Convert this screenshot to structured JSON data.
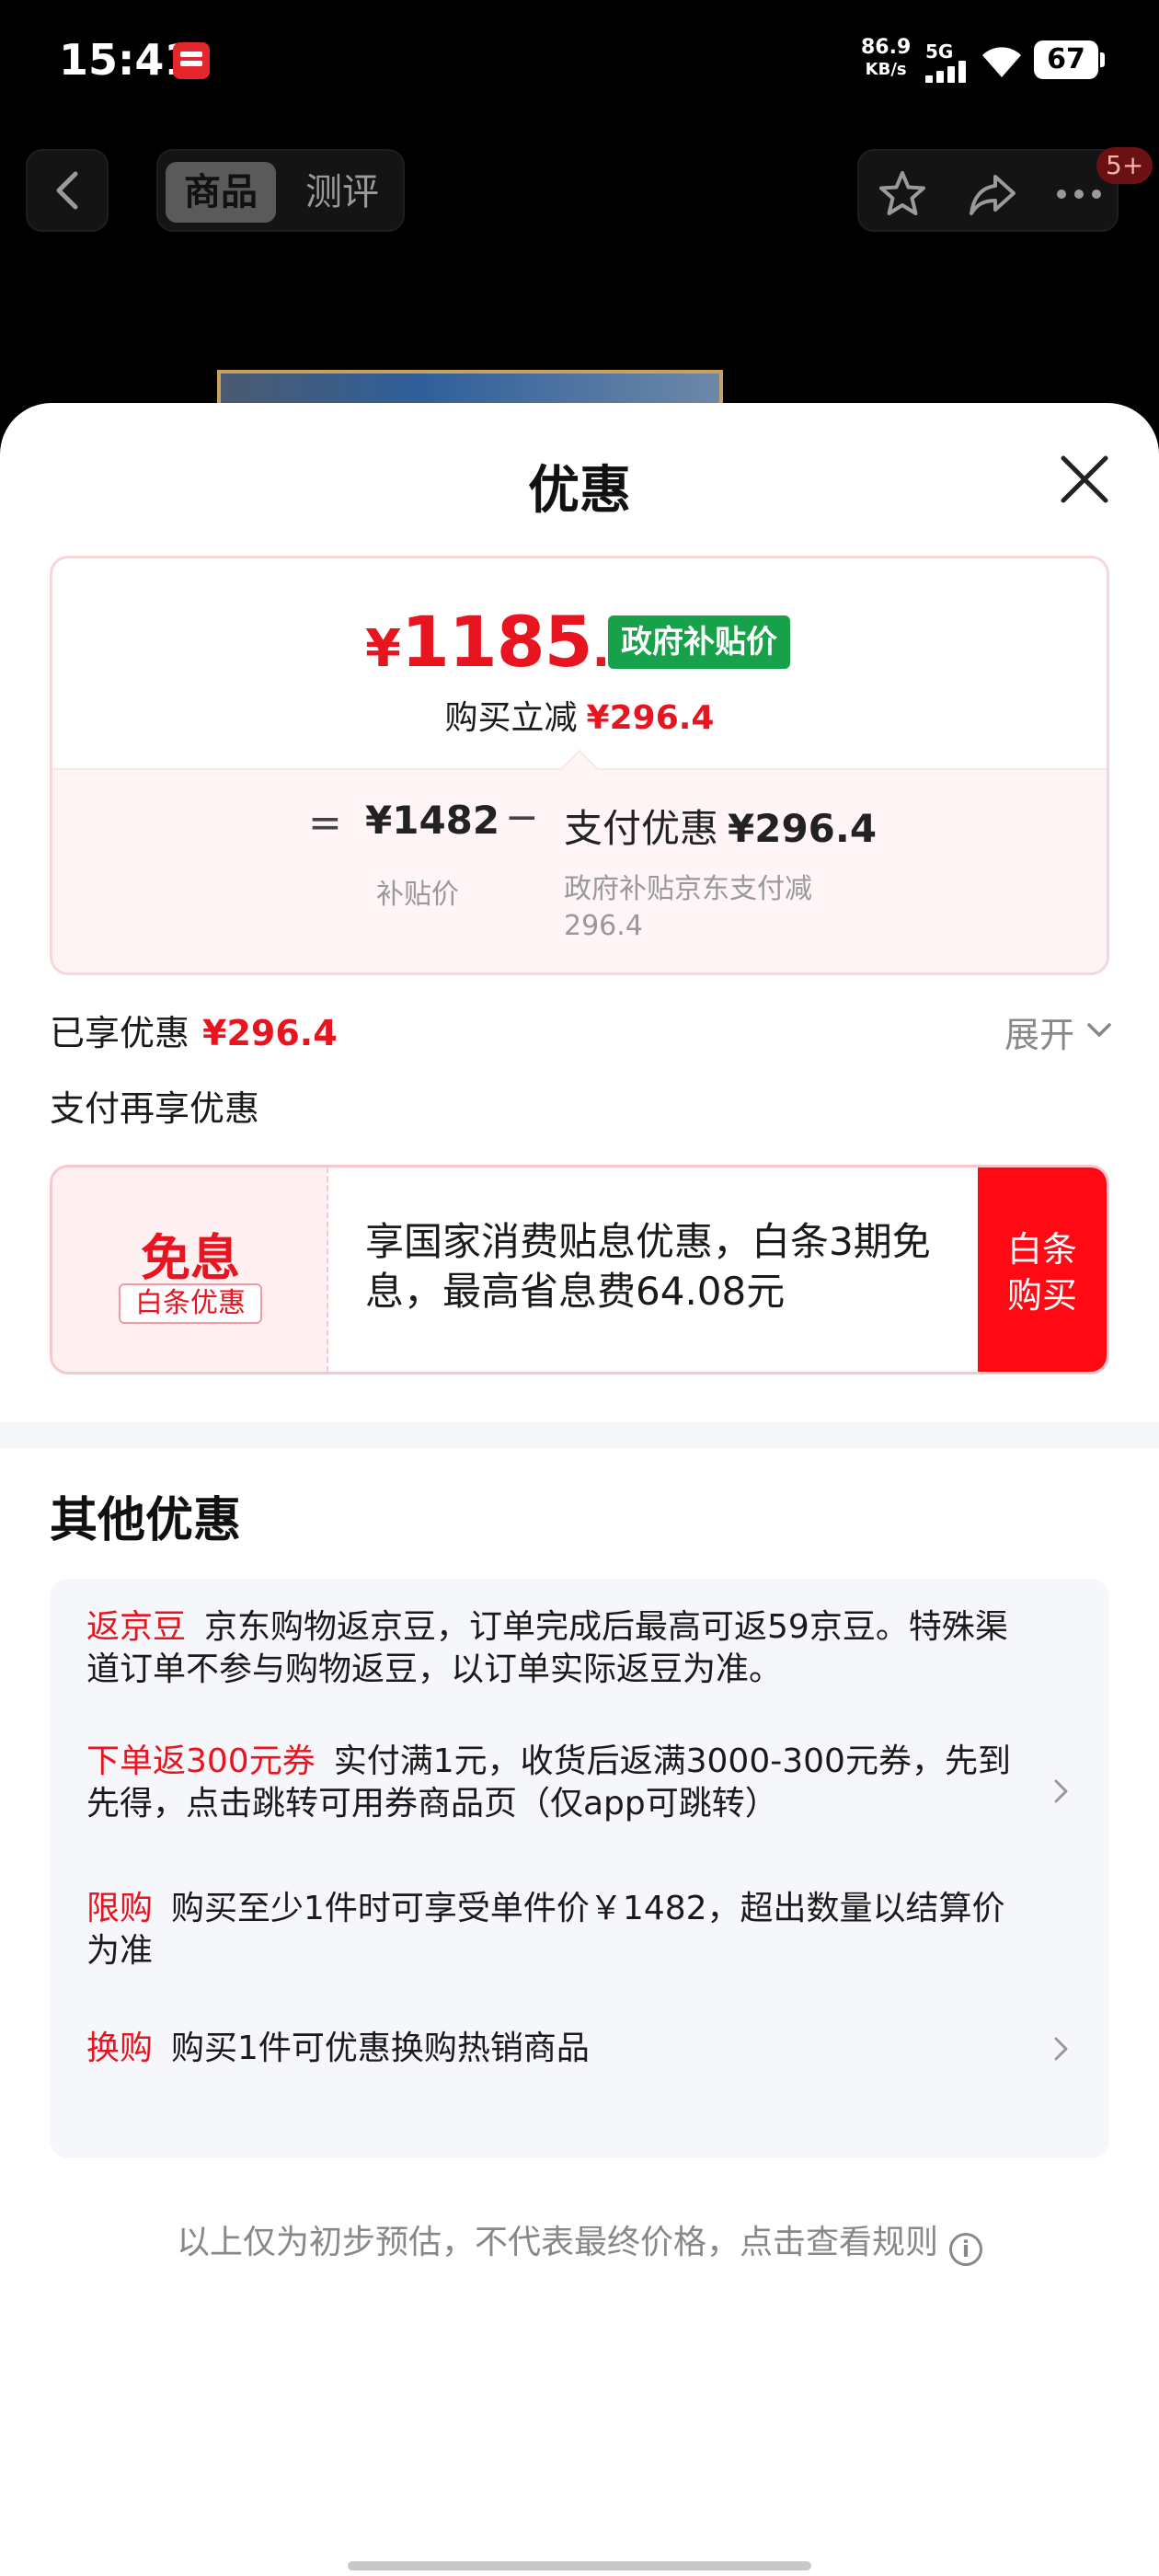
{
  "status_bar": {
    "time": "15:41",
    "net_speed": "86.9",
    "net_unit": "KB/s",
    "network": "5G",
    "battery": "67"
  },
  "top_nav": {
    "tabs": [
      {
        "label": "商品",
        "active": true
      },
      {
        "label": "测评",
        "active": false
      }
    ],
    "more_badge": "5+",
    "icons": [
      "back-icon",
      "star-icon",
      "share-icon",
      "more-icon"
    ]
  },
  "sheet": {
    "title": "优惠",
    "price_card": {
      "yen": "¥",
      "final_int": "1185",
      "final_dec": ".6",
      "gov_tag": "政府补贴价",
      "instant_label": "购买立减",
      "instant_amount": "¥296.4",
      "equals": "=",
      "base_price": "¥1482",
      "base_label": "补贴价",
      "minus": "−",
      "pay_disc_label": "支付优惠",
      "pay_disc_amount": "¥296.4",
      "pay_disc_detail": "政府补贴京东支付减296.4"
    },
    "enjoyed_label": "已享优惠",
    "enjoyed_amount": "¥296.4",
    "expand_label": "展开",
    "pay_more_label": "支付再享优惠",
    "baitiao": {
      "main": "免息",
      "tag": "白条优惠",
      "desc": "享国家消费贴息优惠，白条3期免息，最高省息费64.08元",
      "buy_line1": "白条",
      "buy_line2": "购买"
    },
    "other_title": "其他优惠",
    "promotions": [
      {
        "tag": "返京豆",
        "text": "京东购物返京豆，订单完成后最高可返59京豆。特殊渠道订单不参与购物返豆，以订单实际返豆为准。",
        "arrow": false
      },
      {
        "tag": "下单返300元券",
        "text": "实付满1元，收货后返满3000-300元券，先到先得，点击跳转可用券商品页（仅app可跳转）",
        "arrow": true
      },
      {
        "tag": "限购",
        "text": "购买至少1件时可享受单件价￥1482，超出数量以结算价为准",
        "arrow": false
      },
      {
        "tag": "换购",
        "text": "购买1件可优惠换购热销商品",
        "arrow": true
      }
    ],
    "disclaimer": "以上仅为初步预估，不代表最终价格，点击查看规则",
    "disclaimer_icon": "i"
  },
  "colors": {
    "accent_red": "#e8141f",
    "gov_green": "#17a24a",
    "buy_red": "#ff0a14"
  }
}
